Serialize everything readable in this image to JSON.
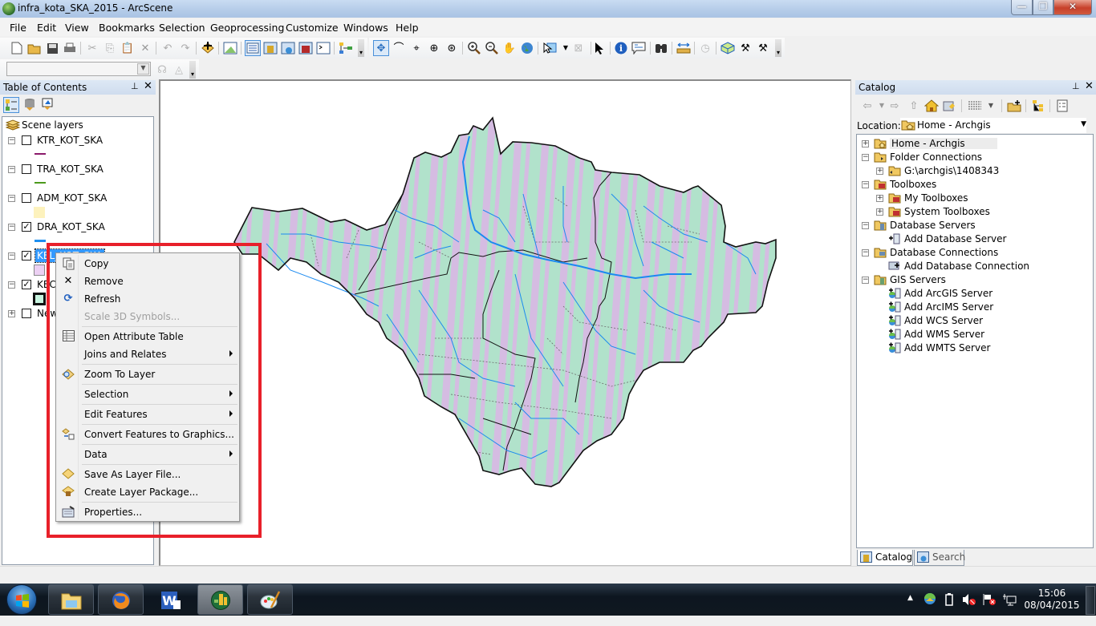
{
  "window": {
    "title": "infra_kota_SKA_2015 - ArcScene",
    "controls": {
      "minimize": "—",
      "maximize": "❐",
      "close": "✕"
    }
  },
  "menubar": {
    "items": [
      "File",
      "Edit",
      "View",
      "Bookmarks",
      "Selection",
      "Geoprocessing",
      "Customize",
      "Windows",
      "Help"
    ]
  },
  "toolbar": {
    "standard": [
      "new-document",
      "open",
      "save",
      "print",
      "cut",
      "copy",
      "paste",
      "delete",
      "undo",
      "redo",
      "add-data",
      "scene-properties",
      "table-of-contents",
      "catalog",
      "search",
      "arctoolbox",
      "python",
      "model-builder"
    ],
    "navigation": [
      "navigate",
      "fly",
      "target-center",
      "zoom-to-target",
      "set-observer",
      "zoom-in",
      "zoom-out",
      "pan",
      "full-extent",
      "select-features",
      "clear-selection",
      "select-elements",
      "identify",
      "html-popup",
      "find",
      "measure",
      "time-slider",
      "3d-effects",
      "hammer-1",
      "hammer-2"
    ],
    "combo_value": ""
  },
  "toc": {
    "title": "Table of Contents",
    "root": "Scene layers",
    "layers": [
      {
        "name": "KTR_KOT_SKA",
        "checked": false,
        "expanded": true,
        "symbol": "line",
        "color": "#8b1a6b"
      },
      {
        "name": "TRA_KOT_SKA",
        "checked": false,
        "expanded": true,
        "symbol": "line",
        "color": "#4c9a1c"
      },
      {
        "name": "ADM_KOT_SKA",
        "checked": false,
        "expanded": true,
        "symbol": "fill",
        "color": "#fdf2bd"
      },
      {
        "name": "DRA_KOT_SKA",
        "checked": true,
        "expanded": true,
        "symbol": "line",
        "color": "#1e8ff0"
      },
      {
        "name": "KEL_KOT_SKA",
        "checked": true,
        "expanded": true,
        "symbol": "fill",
        "color": "#ecd0f3",
        "selected": true
      },
      {
        "name": "KEC_KOT_SKA",
        "checked": true,
        "expanded": true,
        "symbol": "fill-outline",
        "color": "#c8f5e0"
      },
      {
        "name": "New",
        "checked": false,
        "expanded": false
      }
    ]
  },
  "context_menu": {
    "items": [
      {
        "label": "Copy",
        "icon": "copy-icon",
        "glyph": "⎘"
      },
      {
        "label": "Remove",
        "icon": "remove-icon",
        "glyph": "✕"
      },
      {
        "label": "Refresh",
        "icon": "refresh-icon",
        "glyph": "⟳"
      },
      {
        "label": "Scale 3D Symbols...",
        "disabled": true
      },
      {
        "label": "Open Attribute Table",
        "icon": "table-icon",
        "glyph": "▦"
      },
      {
        "label": "Joins and Relates",
        "submenu": true
      },
      {
        "label": "Zoom To Layer",
        "icon": "zoom-layer-icon",
        "glyph": "◈"
      },
      {
        "label": "Selection",
        "submenu": true
      },
      {
        "label": "Edit Features",
        "submenu": true
      },
      {
        "label": "Convert Features to Graphics...",
        "icon": "convert-graphics-icon",
        "glyph": "⇢"
      },
      {
        "label": "Data",
        "submenu": true
      },
      {
        "label": "Save As Layer File...",
        "icon": "layer-file-icon",
        "glyph": "◆"
      },
      {
        "label": "Create Layer Package...",
        "icon": "layer-package-icon",
        "glyph": "◆"
      },
      {
        "label": "Properties...",
        "icon": "properties-icon",
        "glyph": "▤"
      }
    ]
  },
  "map": {
    "fill_green": "#b1e2cb",
    "fill_purple": "#d5bce2",
    "river_color": "#1b8af0",
    "boundary_color": "#111111",
    "dashed_color": "#6b6b6b"
  },
  "catalog": {
    "title": "Catalog",
    "location_label": "Location:",
    "location_value": "Home - Archgis",
    "tree": [
      {
        "label": "Home - Archgis",
        "level": 0,
        "exp": "+",
        "icon": "home-folder",
        "highlight": true
      },
      {
        "label": "Folder Connections",
        "level": 0,
        "exp": "−",
        "icon": "folder-connection"
      },
      {
        "label": "G:\\archgis\\1408343",
        "level": 1,
        "exp": "+",
        "icon": "folder"
      },
      {
        "label": "Toolboxes",
        "level": 0,
        "exp": "−",
        "icon": "toolbox-folder"
      },
      {
        "label": "My Toolboxes",
        "level": 1,
        "exp": "+",
        "icon": "toolbox"
      },
      {
        "label": "System Toolboxes",
        "level": 1,
        "exp": "+",
        "icon": "toolbox"
      },
      {
        "label": "Database Servers",
        "level": 0,
        "exp": "−",
        "icon": "db-server-folder"
      },
      {
        "label": "Add Database Server",
        "level": 1,
        "exp": "",
        "icon": "add-db-server"
      },
      {
        "label": "Database Connections",
        "level": 0,
        "exp": "−",
        "icon": "db-connection-folder"
      },
      {
        "label": "Add Database Connection",
        "level": 1,
        "exp": "",
        "icon": "add-db-connection"
      },
      {
        "label": "GIS Servers",
        "level": 0,
        "exp": "−",
        "icon": "gis-server-folder"
      },
      {
        "label": "Add ArcGIS Server",
        "level": 1,
        "exp": "",
        "icon": "add-server"
      },
      {
        "label": "Add ArcIMS Server",
        "level": 1,
        "exp": "",
        "icon": "add-server"
      },
      {
        "label": "Add WCS Server",
        "level": 1,
        "exp": "",
        "icon": "add-server"
      },
      {
        "label": "Add WMS Server",
        "level": 1,
        "exp": "",
        "icon": "add-server"
      },
      {
        "label": "Add WMTS Server",
        "level": 1,
        "exp": "",
        "icon": "add-server"
      }
    ],
    "tabs": [
      "Catalog",
      "Search"
    ]
  },
  "taskbar": {
    "apps": [
      "Windows Explorer",
      "Firefox",
      "Microsoft Word",
      "ArcScene",
      "Paint"
    ],
    "active": "ArcScene",
    "clock_time": "15:06",
    "clock_date": "08/04/2015"
  }
}
